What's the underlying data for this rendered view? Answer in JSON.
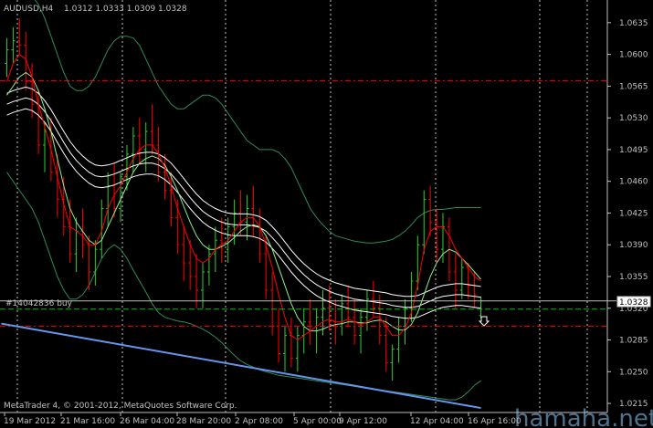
{
  "header": {
    "symbol_timeframe": "AUDUSD,H4",
    "ohlc": "1.0312 1.0333 1.0309 1.0328"
  },
  "order_label": "#14042836 buy",
  "copyright": "MetaTrader 4, © 2001-2012, MetaQuotes Software Corp.",
  "watermark": "hamaha.net",
  "colors": {
    "background": "#000000",
    "grid": "#c0c0c0",
    "bull_candle": "#32cd32",
    "bear_candle": "#ff0000",
    "ma_red": "#ff0000",
    "ma_green": "#90ee90",
    "ma_white": "#ffffff",
    "envelope": "#2e8b57",
    "trendline": "#6495ed",
    "red_level": "#ff0000",
    "green_level": "#00c000",
    "order_line": "#c0c0c0"
  },
  "chart_data": {
    "type": "candlestick",
    "price_axis_labels": [
      "1.0635",
      "1.0600",
      "1.0565",
      "1.0530",
      "1.0495",
      "1.0460",
      "1.0425",
      "1.0390",
      "1.0355",
      "1.0320",
      "1.0285",
      "1.0250",
      "1.0215"
    ],
    "time_axis_labels": [
      "19 Mar 2012",
      "21 Mar 16:00",
      "26 Mar 04:00",
      "28 Mar 20:00",
      "2 Apr 08:00",
      "5 Apr 00:00",
      "9 Apr 12:00",
      "12 Apr 04:00",
      "16 Apr 16:00"
    ],
    "current_price": "1.0328",
    "ylim": [
      1.0205,
      1.066
    ],
    "levels": {
      "red_upper": 1.0571,
      "red_lower": 1.03,
      "green_order": 1.0319,
      "order_entry": 1.0328
    },
    "candles": [
      [
        1.059,
        1.0618,
        1.0575,
        1.0605
      ],
      [
        1.0605,
        1.063,
        1.059,
        1.0615
      ],
      [
        1.0615,
        1.064,
        1.06,
        1.061
      ],
      [
        1.061,
        1.0625,
        1.056,
        1.057
      ],
      [
        1.057,
        1.059,
        1.053,
        1.0545
      ],
      [
        1.0545,
        1.056,
        1.049,
        1.05
      ],
      [
        1.05,
        1.0525,
        1.047,
        1.0515
      ],
      [
        1.0515,
        1.053,
        1.046,
        1.047
      ],
      [
        1.047,
        1.049,
        1.042,
        1.044
      ],
      [
        1.044,
        1.0465,
        1.04,
        1.041
      ],
      [
        1.041,
        1.044,
        1.037,
        1.038
      ],
      [
        1.038,
        1.042,
        1.036,
        1.0405
      ],
      [
        1.0405,
        1.043,
        1.0375,
        1.039
      ],
      [
        1.039,
        1.04,
        1.034,
        1.036
      ],
      [
        1.036,
        1.0395,
        1.0345,
        1.0385
      ],
      [
        1.0385,
        1.044,
        1.0375,
        1.043
      ],
      [
        1.043,
        1.047,
        1.041,
        1.0455
      ],
      [
        1.0455,
        1.048,
        1.042,
        1.043
      ],
      [
        1.043,
        1.047,
        1.0415,
        1.0465
      ],
      [
        1.0465,
        1.05,
        1.045,
        1.049
      ],
      [
        1.049,
        1.052,
        1.047,
        1.051
      ],
      [
        1.051,
        1.053,
        1.048,
        1.0495
      ],
      [
        1.0495,
        1.0525,
        1.047,
        1.0515
      ],
      [
        1.0515,
        1.0545,
        1.049,
        1.05
      ],
      [
        1.05,
        1.052,
        1.046,
        1.047
      ],
      [
        1.047,
        1.049,
        1.044,
        1.045
      ],
      [
        1.045,
        1.047,
        1.041,
        1.042
      ],
      [
        1.042,
        1.044,
        1.038,
        1.039
      ],
      [
        1.039,
        1.041,
        1.035,
        1.037
      ],
      [
        1.037,
        1.0395,
        1.034,
        1.0355
      ],
      [
        1.0355,
        1.038,
        1.032,
        1.034
      ],
      [
        1.034,
        1.037,
        1.032,
        1.036
      ],
      [
        1.036,
        1.039,
        1.0345,
        1.038
      ],
      [
        1.038,
        1.041,
        1.036,
        1.0395
      ],
      [
        1.0395,
        1.042,
        1.037,
        1.0385
      ],
      [
        1.0385,
        1.042,
        1.037,
        1.041
      ],
      [
        1.041,
        1.044,
        1.039,
        1.0425
      ],
      [
        1.0425,
        1.045,
        1.04,
        1.0415
      ],
      [
        1.0415,
        1.0445,
        1.0395,
        1.043
      ],
      [
        1.043,
        1.0455,
        1.04,
        1.041
      ],
      [
        1.041,
        1.043,
        1.037,
        1.038
      ],
      [
        1.038,
        1.04,
        1.033,
        1.034
      ],
      [
        1.034,
        1.036,
        1.029,
        1.03
      ],
      [
        1.03,
        1.032,
        1.026,
        1.027
      ],
      [
        1.027,
        1.03,
        1.025,
        1.029
      ],
      [
        1.029,
        1.031,
        1.0255,
        1.0265
      ],
      [
        1.0265,
        1.03,
        1.025,
        1.029
      ],
      [
        1.029,
        1.032,
        1.027,
        1.0305
      ],
      [
        1.0305,
        1.033,
        1.028,
        1.0295
      ],
      [
        1.0295,
        1.032,
        1.027,
        1.031
      ],
      [
        1.031,
        1.034,
        1.029,
        1.032
      ],
      [
        1.032,
        1.0345,
        1.0295,
        1.0305
      ],
      [
        1.0305,
        1.033,
        1.028,
        1.03
      ],
      [
        1.03,
        1.0335,
        1.029,
        1.0325
      ],
      [
        1.0325,
        1.0345,
        1.03,
        1.031
      ],
      [
        1.031,
        1.033,
        1.028,
        1.029
      ],
      [
        1.029,
        1.032,
        1.027,
        1.031
      ],
      [
        1.031,
        1.034,
        1.0295,
        1.033
      ],
      [
        1.033,
        1.035,
        1.031,
        1.032
      ],
      [
        1.032,
        1.0335,
        1.028,
        1.029
      ],
      [
        1.029,
        1.031,
        1.025,
        1.026
      ],
      [
        1.026,
        1.028,
        1.024,
        1.0275
      ],
      [
        1.0275,
        1.031,
        1.026,
        1.03
      ],
      [
        1.03,
        1.033,
        1.028,
        1.032
      ],
      [
        1.032,
        1.036,
        1.0305,
        1.035
      ],
      [
        1.035,
        1.04,
        1.034,
        1.039
      ],
      [
        1.039,
        1.045,
        1.038,
        1.044
      ],
      [
        1.044,
        1.0455,
        1.04,
        1.0415
      ],
      [
        1.0415,
        1.043,
        1.037,
        1.0385
      ],
      [
        1.0385,
        1.0425,
        1.037,
        1.041
      ],
      [
        1.041,
        1.042,
        1.035,
        1.036
      ],
      [
        1.036,
        1.038,
        1.032,
        1.034
      ],
      [
        1.034,
        1.0375,
        1.033,
        1.0365
      ],
      [
        1.0365,
        1.037,
        1.033,
        1.0345
      ],
      [
        1.0345,
        1.036,
        1.032,
        1.0335
      ],
      [
        1.0312,
        1.0333,
        1.0309,
        1.0328
      ]
    ],
    "ma_red": [
      1.057,
      1.059,
      1.06,
      1.0595,
      1.0575,
      1.0545,
      1.052,
      1.0495,
      1.0465,
      1.0435,
      1.041,
      1.0405,
      1.04,
      1.039,
      1.039,
      1.0405,
      1.043,
      1.0445,
      1.0455,
      1.047,
      1.0485,
      1.0495,
      1.05,
      1.05,
      1.049,
      1.0475,
      1.0455,
      1.043,
      1.041,
      1.039,
      1.0375,
      1.037,
      1.0375,
      1.0385,
      1.039,
      1.0395,
      1.0405,
      1.0415,
      1.042,
      1.042,
      1.041,
      1.039,
      1.0365,
      1.0335,
      1.031,
      1.029,
      1.0285,
      1.029,
      1.0295,
      1.03,
      1.0305,
      1.0308,
      1.0305,
      1.0305,
      1.0308,
      1.0305,
      1.0302,
      1.0305,
      1.031,
      1.031,
      1.03,
      1.029,
      1.029,
      1.0298,
      1.0315,
      1.0345,
      1.0385,
      1.0405,
      1.041,
      1.041,
      1.04,
      1.0385,
      1.0375,
      1.0365,
      1.0355,
      1.035
    ],
    "ma_green": [
      1.0555,
      1.0565,
      1.0575,
      1.058,
      1.0575,
      1.056,
      1.054,
      1.0515,
      1.0485,
      1.0455,
      1.043,
      1.0415,
      1.0405,
      1.0395,
      1.039,
      1.0395,
      1.041,
      1.0425,
      1.044,
      1.0455,
      1.047,
      1.048,
      1.0485,
      1.0488,
      1.0485,
      1.0478,
      1.0465,
      1.045,
      1.0432,
      1.0415,
      1.04,
      1.039,
      1.0385,
      1.0385,
      1.0388,
      1.0392,
      1.0398,
      1.0405,
      1.041,
      1.0412,
      1.041,
      1.04,
      1.0385,
      1.0365,
      1.0345,
      1.0325,
      1.031,
      1.03,
      1.0295,
      1.0295,
      1.0297,
      1.03,
      1.0302,
      1.0303,
      1.0305,
      1.0305,
      1.0304,
      1.0304,
      1.0306,
      1.0307,
      1.0305,
      1.03,
      1.0296,
      1.0296,
      1.0302,
      1.0315,
      1.0335,
      1.0355,
      1.037,
      1.038,
      1.0385,
      1.0382,
      1.0375,
      1.0368,
      1.036,
      1.0352
    ],
    "ma_white": [
      1.0545,
      1.0548,
      1.055,
      1.0552,
      1.055,
      1.0545,
      1.0537,
      1.0527,
      1.0515,
      1.0503,
      1.0492,
      1.0483,
      1.0476,
      1.047,
      1.0466,
      1.0465,
      1.0466,
      1.0468,
      1.0471,
      1.0474,
      1.0477,
      1.0479,
      1.048,
      1.048,
      1.0478,
      1.0474,
      1.0468,
      1.046,
      1.0451,
      1.0442,
      1.0434,
      1.0427,
      1.0422,
      1.0418,
      1.0415,
      1.0413,
      1.0412,
      1.0412,
      1.0412,
      1.0411,
      1.0409,
      1.0405,
      1.0398,
      1.039,
      1.0381,
      1.0372,
      1.0364,
      1.0357,
      1.0351,
      1.0346,
      1.0342,
      1.0339,
      1.0336,
      1.0334,
      1.0332,
      1.033,
      1.0329,
      1.0328,
      1.0327,
      1.0326,
      1.0325,
      1.0323,
      1.0322,
      1.0321,
      1.0321,
      1.0322,
      1.0325,
      1.0328,
      1.0331,
      1.0333,
      1.0334,
      1.0335,
      1.0335,
      1.0334,
      1.0333,
      1.0332
    ],
    "envelope_upper": [
      1.066,
      1.0665,
      1.0668,
      1.0668,
      1.0665,
      1.0655,
      1.064,
      1.062,
      1.06,
      1.058,
      1.0565,
      1.056,
      1.056,
      1.0565,
      1.0575,
      1.059,
      1.0605,
      1.0615,
      1.062,
      1.062,
      1.0618,
      1.061,
      1.0595,
      1.058,
      1.0565,
      1.0555,
      1.0545,
      1.054,
      1.054,
      1.0545,
      1.055,
      1.0555,
      1.0555,
      1.0552,
      1.0545,
      1.0535,
      1.0525,
      1.0515,
      1.0505,
      1.05,
      1.0495,
      1.0495,
      1.0495,
      1.0492,
      1.0485,
      1.0475,
      1.046,
      1.0445,
      1.043,
      1.042,
      1.0412,
      1.0405,
      1.04,
      1.0398,
      1.0396,
      1.0394,
      1.0393,
      1.0392,
      1.0392,
      1.0393,
      1.0394,
      1.0396,
      1.04,
      1.0405,
      1.0412,
      1.042,
      1.0425,
      1.0428,
      1.0429,
      1.0429,
      1.043,
      1.0431,
      1.0431,
      1.0431,
      1.0431,
      1.0431
    ],
    "envelope_lower": [
      1.047,
      1.046,
      1.045,
      1.044,
      1.043,
      1.0415,
      1.0395,
      1.0375,
      1.0355,
      1.034,
      1.033,
      1.033,
      1.0335,
      1.0345,
      1.036,
      1.0375,
      1.0385,
      1.039,
      1.0385,
      1.0375,
      1.0362,
      1.035,
      1.0338,
      1.0325,
      1.0315,
      1.031,
      1.0308,
      1.0306,
      1.0305,
      1.0303,
      1.03,
      1.0297,
      1.0293,
      1.0288,
      1.0282,
      1.0275,
      1.0268,
      1.0262,
      1.0258,
      1.0255,
      1.0252,
      1.025,
      1.0248,
      1.0246,
      1.0245,
      1.0244,
      1.0243,
      1.0242,
      1.0241,
      1.024,
      1.0239,
      1.0238,
      1.0237,
      1.0236,
      1.0235,
      1.0234,
      1.0233,
      1.0232,
      1.0231,
      1.023,
      1.0229,
      1.0228,
      1.0227,
      1.0226,
      1.0225,
      1.0224,
      1.0223,
      1.0222,
      1.0221,
      1.022,
      1.0219,
      1.0219,
      1.0222,
      1.0228,
      1.0235,
      1.024
    ],
    "trendline": [
      [
        0,
        1.0303
      ],
      [
        75,
        1.0215
      ]
    ]
  }
}
